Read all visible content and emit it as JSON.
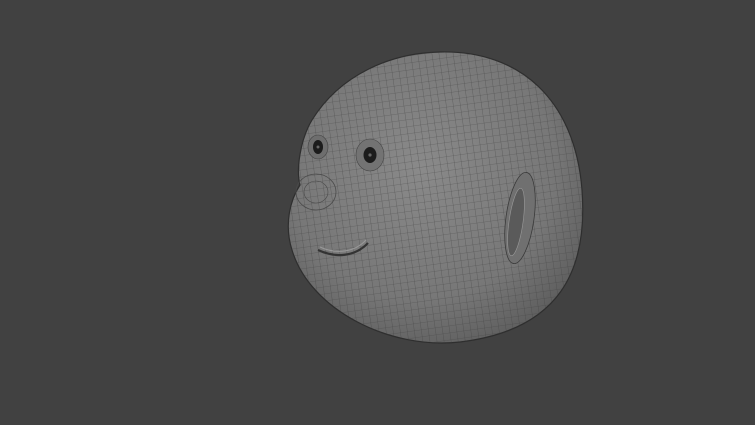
{
  "viewport": {
    "background_color": "#414141",
    "mesh_color": "#7c7c7c",
    "wire_color": "#3a3a3a",
    "object": "wireframe-head-mesh"
  }
}
